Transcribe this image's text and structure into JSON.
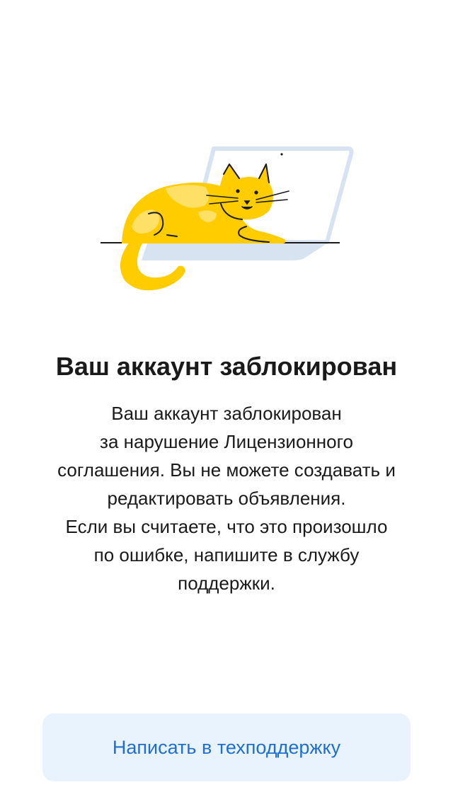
{
  "screen": {
    "illustration": "cat-on-laptop-illustration",
    "title": "Ваш аккаунт заблокирован",
    "message_lines": [
      "Ваш аккаунт заблокирован",
      "за нарушение Лицензионного",
      "соглашения. Вы не можете создавать и",
      "редактировать объявления.",
      "Если вы считаете, что это произошло",
      "по ошибке, напишите в службу",
      "поддержки."
    ],
    "support_button_label": "Написать в техподдержку"
  },
  "colors": {
    "cat": "#ffcc00",
    "cat_highlight": "#ffe066",
    "laptop": "#d7e3f0",
    "button_bg": "#e9f3fd",
    "button_text": "#1f6fd1",
    "text": "#1a1a1a"
  }
}
